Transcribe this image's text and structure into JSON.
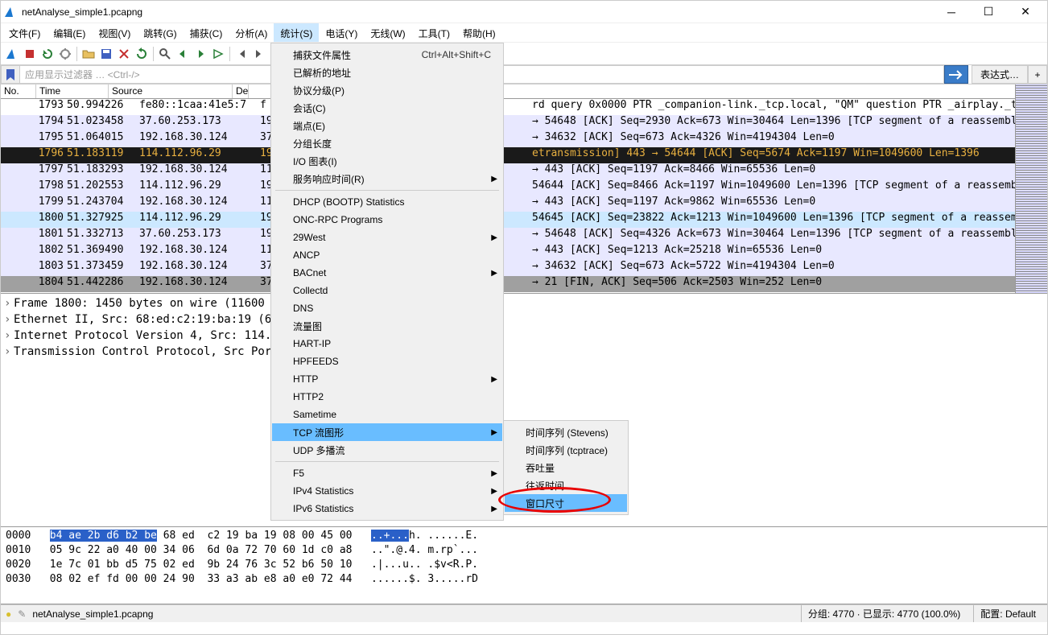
{
  "title": "netAnalyse_simple1.pcapng",
  "menubar": [
    "文件(F)",
    "编辑(E)",
    "视图(V)",
    "跳转(G)",
    "捕获(C)",
    "分析(A)",
    "统计(S)",
    "电话(Y)",
    "无线(W)",
    "工具(T)",
    "帮助(H)"
  ],
  "menubar_open": 6,
  "filter": {
    "placeholder": "应用显示过滤器 … <Ctrl-/>",
    "expression": "表达式…"
  },
  "packet_columns": [
    "No.",
    "Time",
    "Source",
    "De"
  ],
  "packets": [
    {
      "no": "1793",
      "time": "50.994226",
      "src": "fe80::1caa:41e5:7",
      "d": "f",
      "info": "rd query 0x0000 PTR _companion-link._tcp.local, \"QM\" question PTR _airplay._tcp",
      "cls": "r-light"
    },
    {
      "no": "1794",
      "time": "51.023458",
      "src": "37.60.253.173",
      "d": "19",
      "info": "→ 54648 [ACK] Seq=2930 Ack=673 Win=30464 Len=1396 [TCP segment of a reassembled",
      "cls": "r-blue"
    },
    {
      "no": "1795",
      "time": "51.064015",
      "src": "192.168.30.124",
      "d": "37",
      "info": "→ 34632 [ACK] Seq=673 Ack=4326 Win=4194304 Len=0",
      "cls": "r-blue"
    },
    {
      "no": "1796",
      "time": "51.183119",
      "src": "114.112.96.29",
      "d": "19",
      "info": "etransmission] 443 → 54644 [ACK] Seq=5674 Ack=1197 Win=1049600 Len=1396",
      "cls": "r-sel-dk"
    },
    {
      "no": "1797",
      "time": "51.183293",
      "src": "192.168.30.124",
      "d": "11",
      "info": "→ 443 [ACK] Seq=1197 Ack=8466 Win=65536 Len=0",
      "cls": "r-blue"
    },
    {
      "no": "1798",
      "time": "51.202553",
      "src": "114.112.96.29",
      "d": "19",
      "info": "54644 [ACK] Seq=8466 Ack=1197 Win=1049600 Len=1396 [TCP segment of a reassemble",
      "cls": "r-blue"
    },
    {
      "no": "1799",
      "time": "51.243704",
      "src": "192.168.30.124",
      "d": "11",
      "info": "→ 443 [ACK] Seq=1197 Ack=9862 Win=65536 Len=0",
      "cls": "r-blue"
    },
    {
      "no": "1800",
      "time": "51.327925",
      "src": "114.112.96.29",
      "d": "19",
      "info": "54645 [ACK] Seq=23822 Ack=1213 Win=1049600 Len=1396 [TCP segment of a reassembl",
      "cls": "r-ltblue"
    },
    {
      "no": "1801",
      "time": "51.332713",
      "src": "37.60.253.173",
      "d": "19",
      "info": "→ 54648 [ACK] Seq=4326 Ack=673 Win=30464 Len=1396 [TCP segment of a reassembled",
      "cls": "r-blue"
    },
    {
      "no": "1802",
      "time": "51.369490",
      "src": "192.168.30.124",
      "d": "11",
      "info": "→ 443 [ACK] Seq=1213 Ack=25218 Win=65536 Len=0",
      "cls": "r-blue"
    },
    {
      "no": "1803",
      "time": "51.373459",
      "src": "192.168.30.124",
      "d": "37",
      "info": "→ 34632 [ACK] Seq=673 Ack=5722 Win=4194304 Len=0",
      "cls": "r-blue"
    },
    {
      "no": "1804",
      "time": "51.442286",
      "src": "192.168.30.124",
      "d": "37",
      "info": "→ 21 [FIN, ACK] Seq=506 Ack=2503 Win=252 Len=0",
      "cls": "r-grey-sel"
    }
  ],
  "tree": [
    "Frame 1800: 1450 bytes on wire (11600 b                          ) on interface 0",
    "Ethernet II, Src: 68:ed:c2:19:ba:19 (68                          :be (b4:ae:2b:d6:b2:be)",
    "Internet Protocol Version 4, Src: 114.1",
    "Transmission Control Protocol, Src Port                          ck: 1213, Len: 1396"
  ],
  "hex": [
    {
      "off": "0000",
      "b": "b4 ae 2b d6 b2 be 68 ed  c2 19 ba 19 08 00 45 00",
      "a": "..+...h. ......E.",
      "selb": [
        0,
        5
      ],
      "sela": [
        0,
        5
      ]
    },
    {
      "off": "0010",
      "b": "05 9c 22 a0 40 00 34 06  6d 0a 72 70 60 1d c0 a8",
      "a": "..\".@.4. m.rp`..."
    },
    {
      "off": "0020",
      "b": "1e 7c 01 bb d5 75 02 ed  9b 24 76 3c 52 b6 50 10",
      "a": ".|...u.. .$v<R.P."
    },
    {
      "off": "0030",
      "b": "08 02 ef fd 00 00 24 90  33 a3 ab e8 a0 e0 72 44",
      "a": "......$. 3.....rD"
    }
  ],
  "dropdown": [
    {
      "label": "捕获文件属性",
      "shortcut": "Ctrl+Alt+Shift+C"
    },
    {
      "label": "已解析的地址"
    },
    {
      "label": "协议分级(P)"
    },
    {
      "label": "会话(C)"
    },
    {
      "label": "端点(E)"
    },
    {
      "label": "分组长度"
    },
    {
      "label": "I/O 图表(I)"
    },
    {
      "label": "服务响应时间(R)",
      "sub": true
    },
    {
      "sep": true
    },
    {
      "label": "DHCP (BOOTP) Statistics"
    },
    {
      "label": "ONC-RPC Programs"
    },
    {
      "label": "29West",
      "sub": true
    },
    {
      "label": "ANCP"
    },
    {
      "label": "BACnet",
      "sub": true
    },
    {
      "label": "Collectd"
    },
    {
      "label": "DNS"
    },
    {
      "label": "流量图"
    },
    {
      "label": "HART-IP"
    },
    {
      "label": "HPFEEDS"
    },
    {
      "label": "HTTP",
      "sub": true
    },
    {
      "label": "HTTP2"
    },
    {
      "label": "Sametime"
    },
    {
      "label": "TCP 流图形",
      "sub": true,
      "hl": true
    },
    {
      "label": "UDP 多播流"
    },
    {
      "sep": true
    },
    {
      "label": "F5",
      "sub": true
    },
    {
      "label": "IPv4 Statistics",
      "sub": true
    },
    {
      "label": "IPv6 Statistics",
      "sub": true
    }
  ],
  "submenu": [
    {
      "label": "时间序列 (Stevens)"
    },
    {
      "label": "时间序列 (tcptrace)"
    },
    {
      "label": "吞吐量"
    },
    {
      "label": "往返时间"
    },
    {
      "label": "窗口尺寸",
      "hl": true
    }
  ],
  "status": {
    "file": "netAnalyse_simple1.pcapng",
    "packets": "分组: 4770 · 已显示: 4770 (100.0%)",
    "profile": "配置: Default"
  }
}
